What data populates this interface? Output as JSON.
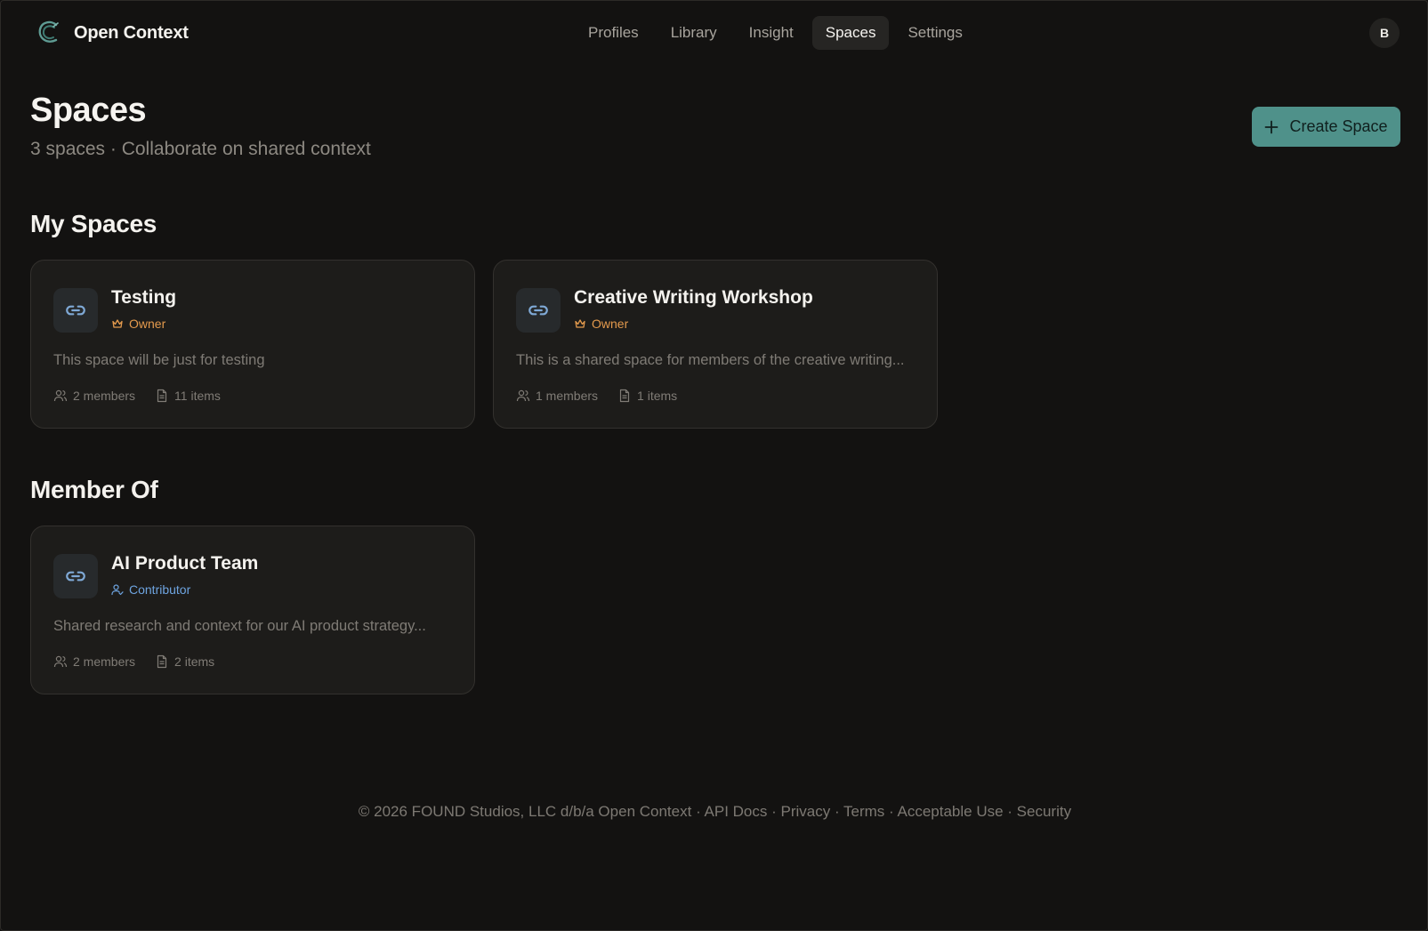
{
  "app": {
    "name": "Open Context",
    "avatar_initial": "B"
  },
  "nav": {
    "items": [
      {
        "label": "Profiles",
        "active": false
      },
      {
        "label": "Library",
        "active": false
      },
      {
        "label": "Insight",
        "active": false
      },
      {
        "label": "Spaces",
        "active": true
      },
      {
        "label": "Settings",
        "active": false
      }
    ]
  },
  "page": {
    "title": "Spaces",
    "subtitle": "3 spaces · Collaborate on shared context",
    "create_label": "Create Space"
  },
  "sections": {
    "my_spaces": {
      "title": "My Spaces",
      "cards": [
        {
          "title": "Testing",
          "role": "Owner",
          "description": "This space will be just for testing",
          "members": "2 members",
          "items": "11 items"
        },
        {
          "title": "Creative Writing Workshop",
          "role": "Owner",
          "description": "This is a shared space for members of the creative writing...",
          "members": "1 members",
          "items": "1 items"
        }
      ]
    },
    "member_of": {
      "title": "Member Of",
      "cards": [
        {
          "title": "AI Product Team",
          "role": "Contributor",
          "description": "Shared research and context for our AI product strategy...",
          "members": "2 members",
          "items": "2 items"
        }
      ]
    }
  },
  "footer": {
    "copyright": "© 2026 FOUND Studios, LLC d/b/a Open Context",
    "separator": " · ",
    "links": [
      "API Docs",
      "Privacy",
      "Terms",
      "Acceptable Use",
      "Security"
    ]
  },
  "colors": {
    "background": "#131211",
    "card": "#1d1c1a",
    "accent": "#4f918a",
    "owner": "#e49a4d",
    "contributor": "#6ea4e0",
    "link_icon": "#7fa9d6"
  },
  "icons": {
    "logo": "c-brand-icon",
    "card": "link-icon",
    "owner_role": "crown-icon",
    "contributor_role": "user-check-icon",
    "members": "users-icon",
    "items": "file-icon",
    "create": "plus-icon"
  }
}
